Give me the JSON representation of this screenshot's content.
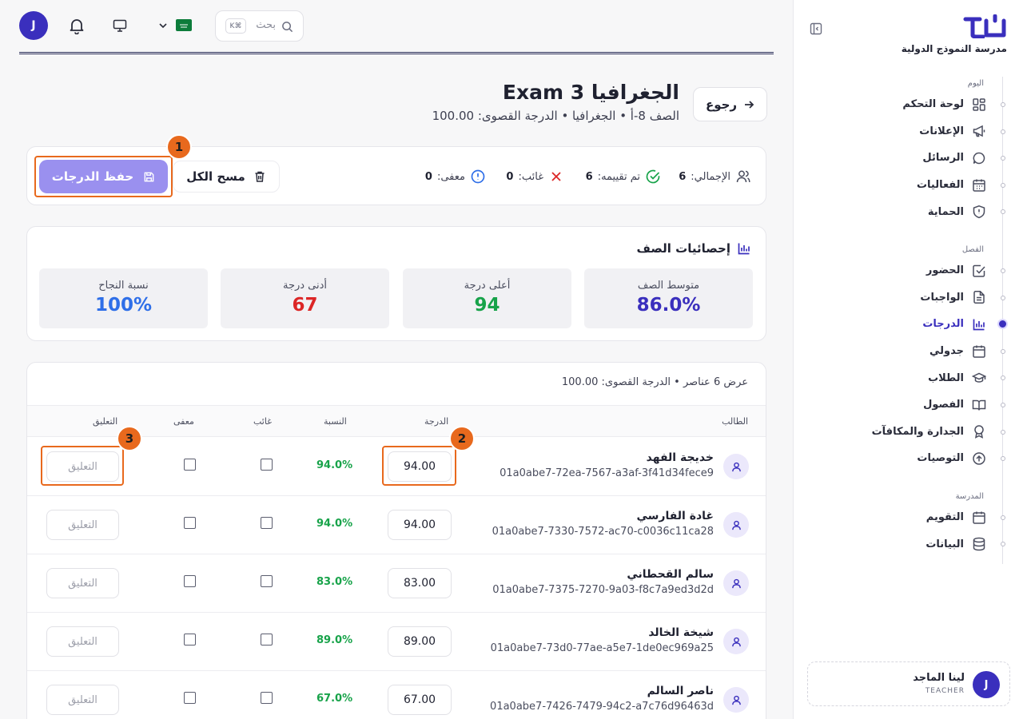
{
  "sidebar": {
    "school_name": "مدرسة النموذج الدولية",
    "sections": [
      {
        "label": "اليوم",
        "items": [
          {
            "label": "لوحة التحكم",
            "icon": "dashboard-icon"
          },
          {
            "label": "الإعلانات",
            "icon": "megaphone-icon"
          },
          {
            "label": "الرسائل",
            "icon": "chat-icon"
          },
          {
            "label": "الفعاليات",
            "icon": "calendar-grid-icon"
          },
          {
            "label": "الحماية",
            "icon": "shield-icon"
          }
        ]
      },
      {
        "label": "الفصل",
        "items": [
          {
            "label": "الحضور",
            "icon": "check-square-icon"
          },
          {
            "label": "الواجبات",
            "icon": "document-icon"
          },
          {
            "label": "الدرجات",
            "icon": "bar-chart-icon",
            "active": true
          },
          {
            "label": "جدولي",
            "icon": "calendar-icon"
          },
          {
            "label": "الطلاب",
            "icon": "graduation-cap-icon"
          },
          {
            "label": "الفصول",
            "icon": "book-icon"
          },
          {
            "label": "الجدارة والمكافآت",
            "icon": "award-icon"
          },
          {
            "label": "التوصيات",
            "icon": "arrow-up-circle-icon"
          }
        ]
      },
      {
        "label": "المدرسة",
        "items": [
          {
            "label": "التقويم",
            "icon": "calendar-icon"
          },
          {
            "label": "البيانات",
            "icon": "database-icon"
          }
        ]
      }
    ],
    "user": {
      "initial": "J",
      "name": "لينا الماجد",
      "role": "TEACHER"
    }
  },
  "topbar": {
    "avatar_initial": "J",
    "search_placeholder": "بحث",
    "search_shortcut": "K⌘"
  },
  "header": {
    "back_label": "رجوع",
    "title": "الجغرافيا Exam 3",
    "subtitle": "الصف 8-أ • الجغرافيا • الدرجة القصوى: 100.00"
  },
  "toolbar": {
    "total_label": "الإجمالي:",
    "total_value": "6",
    "graded_label": "تم تقييمه:",
    "graded_value": "6",
    "absent_label": "غائب:",
    "absent_value": "0",
    "exempt_label": "معفى:",
    "exempt_value": "0",
    "clear_label": "مسح الكل",
    "save_label": "حفظ الدرجات"
  },
  "stats": {
    "title": "إحصائيات الصف",
    "boxes": [
      {
        "caption": "متوسط الصف",
        "value": "86.0%",
        "color": "#3a2fbd"
      },
      {
        "caption": "أعلى درجة",
        "value": "94",
        "color": "#18a34a"
      },
      {
        "caption": "أدنى درجة",
        "value": "67",
        "color": "#dc2626"
      },
      {
        "caption": "نسبة النجاح",
        "value": "100%",
        "color": "#2f6fe8"
      }
    ]
  },
  "table": {
    "info": "عرض 6 عناصر • الدرجة القصوى: 100.00",
    "headers": {
      "student": "الطالب",
      "grade": "الدرجة",
      "percent": "النسبة",
      "absent": "غائب",
      "exempt": "معفى",
      "comment": "التعليق"
    },
    "comment_placeholder": "التعليق",
    "rows": [
      {
        "name": "خديجة الفهد",
        "id": "01a0abe7-72ea-7567-a3af-3f41d34fece9",
        "grade": "94.00",
        "percent": "94.0%"
      },
      {
        "name": "غادة الفارسي",
        "id": "01a0abe7-7330-7572-ac70-c0036c11ca28",
        "grade": "94.00",
        "percent": "94.0%"
      },
      {
        "name": "سالم القحطاني",
        "id": "01a0abe7-7375-7270-9a03-f8c7a9ed3d2d",
        "grade": "83.00",
        "percent": "83.0%"
      },
      {
        "name": "شيخة الخالد",
        "id": "01a0abe7-73d0-77ae-a5e7-1de0ec969a25",
        "grade": "89.00",
        "percent": "89.0%"
      },
      {
        "name": "ناصر السالم",
        "id": "01a0abe7-7426-7479-94c2-a7c76d96463d",
        "grade": "67.00",
        "percent": "67.0%"
      }
    ]
  },
  "annotations": [
    "1",
    "2",
    "3"
  ],
  "colors": {
    "accent": "#3a2fbd",
    "highlight": "#e8691d",
    "save_button": "#9a90ef",
    "success": "#18a34a",
    "danger": "#dc2626"
  }
}
